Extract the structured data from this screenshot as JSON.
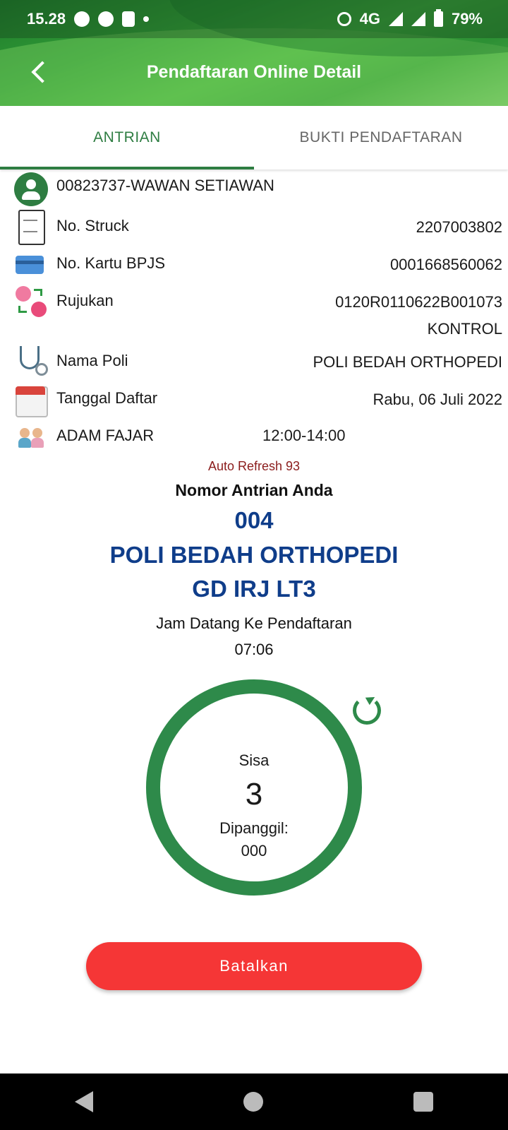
{
  "status_bar": {
    "time": "15.28",
    "network": "4G",
    "battery": "79%"
  },
  "app_bar": {
    "title": "Pendaftaran Online Detail"
  },
  "tabs": [
    {
      "label": "ANTRIAN",
      "active": true
    },
    {
      "label": "BUKTI PENDAFTARAN",
      "active": false
    }
  ],
  "patient": {
    "name": "00823737-WAWAN SETIAWAN"
  },
  "details": {
    "struck_label": "No. Struck",
    "struck_value": "2207003802",
    "bpjs_label": "No. Kartu BPJS",
    "bpjs_value": "0001668560062",
    "rujukan_label": "Rujukan",
    "rujukan_value": "0120R0110622B001073",
    "rujukan_type": "KONTROL",
    "poli_label": "Nama Poli",
    "poli_value": "POLI BEDAH ORTHOPEDI",
    "date_label": "Tanggal Daftar",
    "date_value": "Rabu, 06 Juli 2022",
    "doctor_name": "ADAM FAJAR",
    "doctor_time": "12:00-14:00"
  },
  "queue": {
    "auto_refresh": "Auto Refresh 93",
    "heading": "Nomor Antrian Anda",
    "number": "004",
    "poli": "POLI BEDAH ORTHOPEDI",
    "location": "GD IRJ LT3",
    "arrive_label": "Jam Datang Ke Pendaftaran",
    "arrive_time": "07:06",
    "remaining_label": "Sisa",
    "remaining_value": "3",
    "called_label": "Dipanggil:",
    "called_value": "000"
  },
  "actions": {
    "cancel_label": "Batalkan"
  },
  "colors": {
    "primary_green": "#2e7d42",
    "ring_green": "#2e8a4a",
    "queue_blue": "#0f3d8a",
    "cancel_red": "#f53636",
    "refresh_red": "#8b1c1c"
  }
}
